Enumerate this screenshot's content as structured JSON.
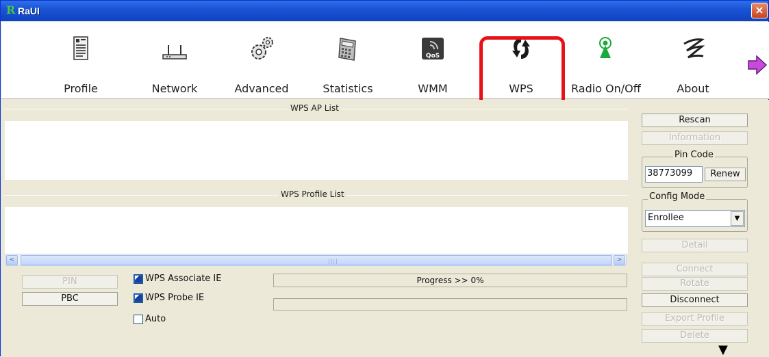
{
  "window": {
    "title": "RaUI",
    "app_icon": "R",
    "close_label": "×"
  },
  "toolbar": {
    "items": [
      {
        "label": "Profile",
        "icon": "profile-icon"
      },
      {
        "label": "Network",
        "icon": "network-router-icon"
      },
      {
        "label": "Advanced",
        "icon": "gears-icon"
      },
      {
        "label": "Statistics",
        "icon": "calculator-icon"
      },
      {
        "label": "WMM",
        "icon": "qos-icon",
        "icon_text": "QoS"
      },
      {
        "label": "WPS",
        "icon": "wps-icon"
      },
      {
        "label": "Radio On/Off",
        "icon": "radio-icon"
      },
      {
        "label": "About",
        "icon": "about-icon"
      }
    ],
    "next_icon": "right-arrow-icon",
    "highlight_color": "#e8111a"
  },
  "wps_ap_list": {
    "title": "WPS AP List"
  },
  "wps_profile_list": {
    "title": "WPS Profile List"
  },
  "scrollbar": {
    "left": "<",
    "right": ">",
    "grip": "||||"
  },
  "buttons": {
    "pin": "PIN",
    "pbc": "PBC",
    "rescan": "Rescan",
    "information": "Information",
    "renew": "Renew",
    "detail": "Detail",
    "connect": "Connect",
    "rotate": "Rotate",
    "disconnect": "Disconnect",
    "export_profile": "Export Profile",
    "delete": "Delete"
  },
  "checkboxes": {
    "associate_ie": {
      "label": "WPS Associate IE",
      "checked": true
    },
    "probe_ie": {
      "label": "WPS Probe IE",
      "checked": true
    },
    "auto": {
      "label": "Auto",
      "checked": false
    }
  },
  "progress": {
    "text": "Progress >> 0%",
    "value_percent": 0
  },
  "pin_code": {
    "label": "Pin Code",
    "value": "38773099"
  },
  "config_mode": {
    "label": "Config Mode",
    "selected": "Enrollee"
  },
  "more_indicator": "▼"
}
